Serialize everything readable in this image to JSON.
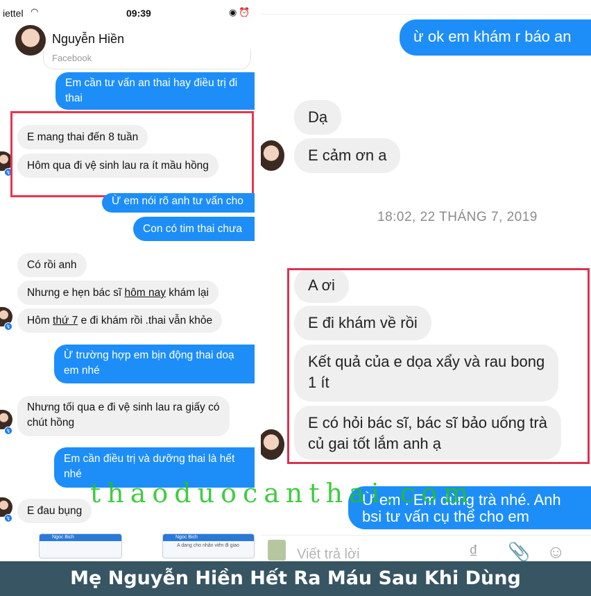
{
  "status_bar": {
    "carrier": "iettel",
    "time": "09:39",
    "wifi_icon": "wifi-icon",
    "right_icons": "◉ ⏰"
  },
  "header": {
    "contact_name": "Nguyễn Hiền"
  },
  "source_label": "Facebook",
  "left_messages": [
    {
      "text": "Em cần tư vấn an thai hay điều trị đi"
    },
    {
      "text": "thai"
    },
    {
      "text": "E mang thai đến 8 tuần"
    },
    {
      "text": "Hôm qua đi vệ sinh lau ra ít mầu hồng"
    },
    {
      "text": "Ừ em nói rõ anh tư vấn cho"
    },
    {
      "text": "Con có tim thai chưa"
    },
    {
      "text": "Có rồi anh"
    },
    {
      "pre": "Nhưng e hẹn bác sĩ ",
      "u": "hôm nay",
      "post": " khám lại"
    },
    {
      "pre": "Hôm ",
      "u": "thứ 7",
      "post": " e đi khám rồi .thai vẫn khỏe"
    },
    {
      "line1": "Ừ trường hợp em bịn động thai doạ",
      "line2": "em nhé"
    },
    {
      "line1": "Nhưng tối qua e đi vệ sinh lau ra giấy có",
      "line2": "chút hồng"
    },
    {
      "line1": "Em cần điều trị và dưỡng thai là hết",
      "line2": "nhé"
    },
    {
      "text": "E đau bụng"
    }
  ],
  "thumbnails": [
    {
      "name": "Ngoc Bich"
    },
    {
      "name": "Ngoc Bich",
      "preview": "A dang cho nhân viên đi giao"
    }
  ],
  "right_messages": [
    {
      "text": "ừ ok em khám r báo an"
    },
    {
      "text": "Dạ"
    },
    {
      "text": "E cảm ơn a"
    },
    {
      "text": "A ơi"
    },
    {
      "text": "E đi khám về rồi"
    },
    {
      "line1": "Kết quả của e dọa xẩy và rau bong",
      "line2": "1 ít"
    },
    {
      "line1": "E có hỏi bác sĩ, bác sĩ bảo uống trà",
      "line2": "củ gai tốt lắm anh ạ"
    },
    {
      "line1": "Ừ em . Em dùng trà nhé. Anh",
      "line2": "bsi tư vấn cụ thể cho em"
    }
  ],
  "timestamp": "18:02, 22 THÁNG 7, 2019",
  "composer": {
    "placeholder": "Viết trả lời",
    "icons": [
      "camera-icon",
      "dong-icon",
      "attachment-icon",
      "emoji-icon"
    ]
  },
  "watermark": "thaoduocanthai.com",
  "caption": "Mẹ Nguyễn Hiền Hết Ra Máu Sau Khi Dùng",
  "colors": {
    "outgoing": "#1d8ef8",
    "incoming": "#f0f0f0",
    "highlight": "#e8344f",
    "caption_bg": "#375563",
    "watermark": "#1fc41f"
  }
}
